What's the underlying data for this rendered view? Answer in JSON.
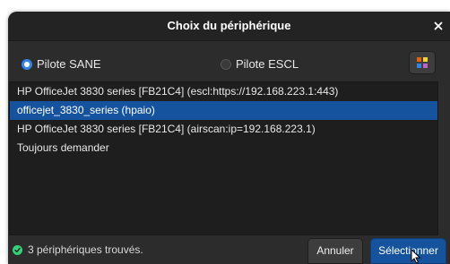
{
  "dialog": {
    "title": "Choix du périphérique"
  },
  "drivers": {
    "sane_label": "Pilote SANE",
    "escl_label": "Pilote ESCL",
    "selected": "sane"
  },
  "devices": [
    {
      "label": "HP OfficeJet 3830 series [FB21C4] (escl:https://192.168.223.1:443)",
      "selected": false
    },
    {
      "label": "officejet_3830_series (hpaio)",
      "selected": true
    },
    {
      "label": "HP OfficeJet 3830 series [FB21C4] (airscan:ip=192.168.223.1)",
      "selected": false
    },
    {
      "label": "Toujours demander",
      "selected": false
    }
  ],
  "status": {
    "text": "3 périphériques trouvés.",
    "icon": "check-circle-icon"
  },
  "buttons": {
    "cancel_label": "Annuler",
    "select_label": "Sélectionner"
  },
  "colors": {
    "accent": "#15539e",
    "radio_accent": "#3584e4",
    "success": "#33d17a",
    "background": "#2c2c2c"
  }
}
